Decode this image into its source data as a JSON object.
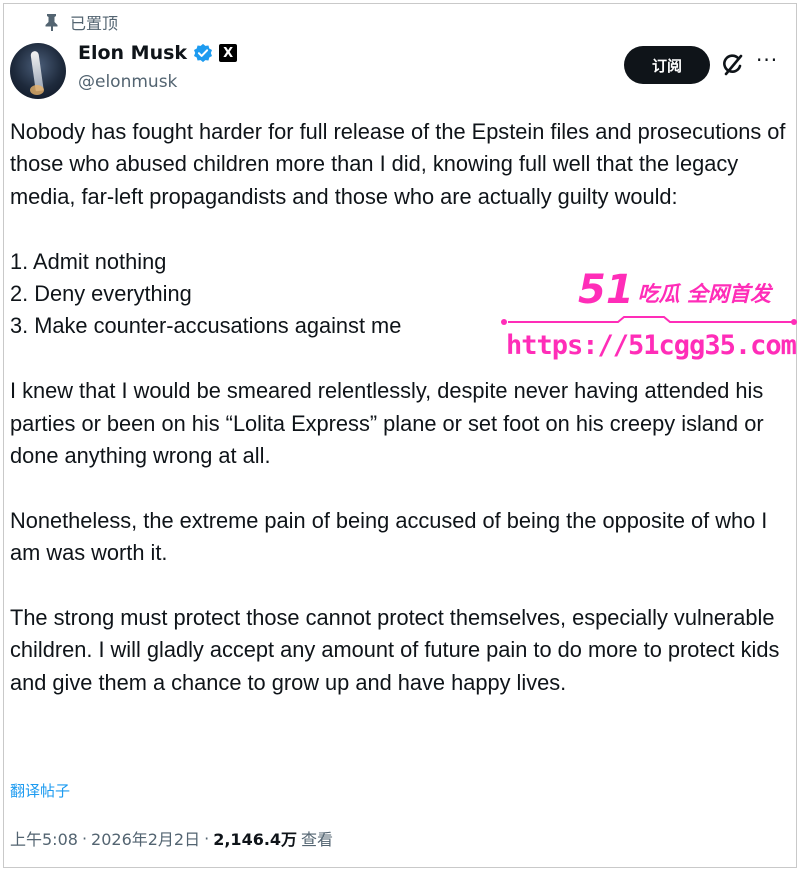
{
  "pinned": {
    "label": "已置顶",
    "icon": "pin-icon"
  },
  "author": {
    "display_name": "Elon Musk",
    "handle": "@elonmusk",
    "verified_icon": "verified-badge-icon",
    "affiliate_icon": "x-logo-icon",
    "affiliate_text": "X"
  },
  "actions": {
    "subscribe_label": "订阅",
    "grok_icon": "grok-icon",
    "more_label": "···"
  },
  "post": {
    "paragraphs": [
      "Nobody has fought harder for full release of the Epstein files and prosecutions of those who abused children more than I did, knowing full well that the legacy media, far-left propagandists and those who are actually guilty would:",
      "1. Admit nothing\n2. Deny everything\n3. Make counter-accusations against me",
      "I knew that I would be smeared relentlessly, despite never having attended his parties or been on his “Lolita Express” plane or set foot on his creepy island or done anything wrong at all.",
      "Nonetheless, the extreme pain of being accused of being the opposite of who I am was worth it.",
      "The strong must protect those cannot protect themselves, especially vulnerable children. I will gladly accept any amount of future pain to do more to protect kids and give them a chance to grow up and have happy lives."
    ],
    "translate_label": "翻译帖子"
  },
  "meta": {
    "time": "上午5:08",
    "separator": "·",
    "date": "2026年2月2日",
    "views_count": "2,146.4万",
    "views_label": "查看"
  },
  "watermark": {
    "brand_number": "51",
    "slogan": "吃瓜 全网首发",
    "url": "https://51cgg35.com"
  },
  "colors": {
    "text": "#0f1419",
    "secondary": "#536471",
    "link": "#1d9bf0",
    "verified": "#1d9bf0",
    "watermark": "#ff2db8"
  }
}
